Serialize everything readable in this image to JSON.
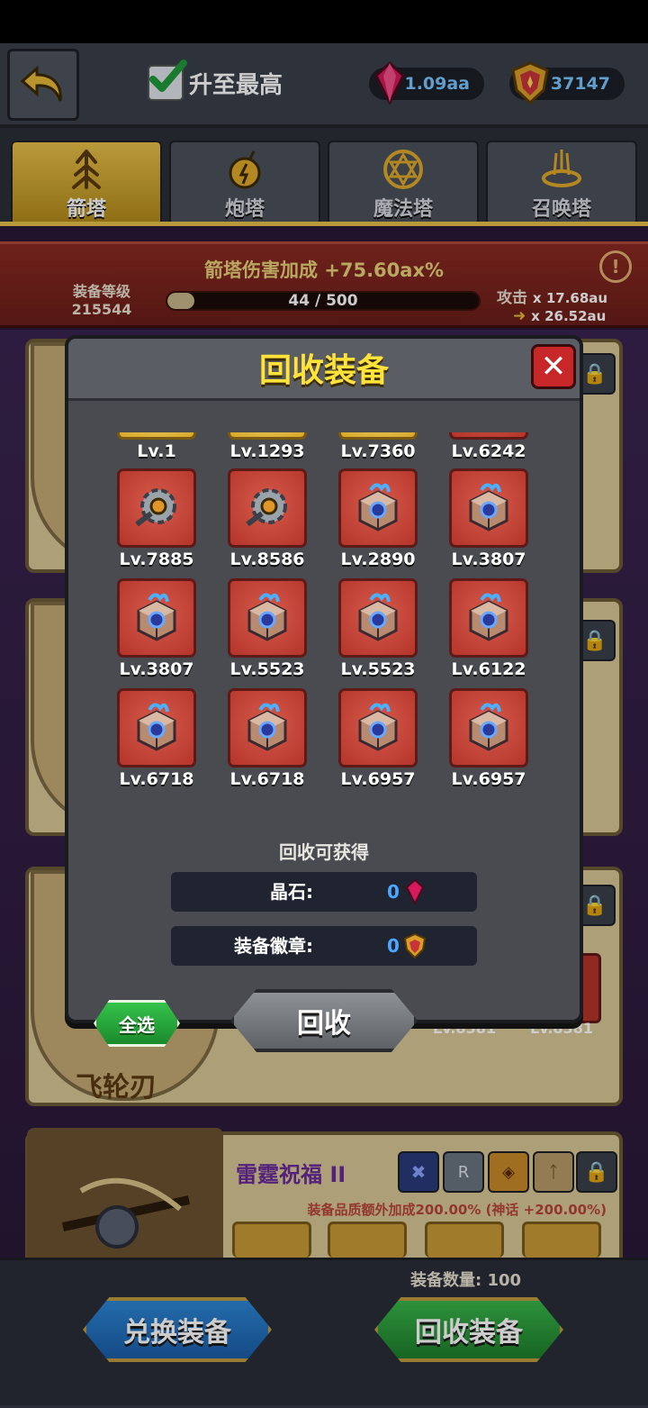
{
  "topbar": {
    "auto_max_label": "升至最高",
    "gems": "1.09aa",
    "badges": "37147"
  },
  "tabs": [
    {
      "label": "箭塔",
      "active": true,
      "icon": "arrow-tower-icon"
    },
    {
      "label": "炮塔",
      "active": false,
      "icon": "cannon-tower-icon"
    },
    {
      "label": "魔法塔",
      "active": false,
      "icon": "magic-tower-icon"
    },
    {
      "label": "召唤塔",
      "active": false,
      "icon": "summon-tower-icon"
    }
  ],
  "bonus": {
    "title": "箭塔伤害加成 +75.60ax%",
    "equip_level_label": "装备等级",
    "equip_level_value": "215544",
    "progress_text": "44 / 500",
    "progress_fraction": 0.088,
    "attack_label": "攻击",
    "attack_current": "x 17.68au",
    "attack_next": "x 26.52au"
  },
  "background_cards": {
    "card3_name": "飞轮刃",
    "card4_name": "雷霆祝福 II",
    "card4_bonus": "装备品质额外加成200.00% (神话 +200.00%)",
    "slot_lv_a": "Lv.8381",
    "slot_lv_b": "Lv.8381"
  },
  "modal": {
    "title": "回收装备",
    "items": [
      {
        "lv": "Lv.1",
        "kind": "gold"
      },
      {
        "lv": "Lv.1293",
        "kind": "gold"
      },
      {
        "lv": "Lv.7360",
        "kind": "gold"
      },
      {
        "lv": "Lv.6242",
        "kind": "red-cube"
      },
      {
        "lv": "Lv.7885",
        "kind": "gear"
      },
      {
        "lv": "Lv.8586",
        "kind": "gear"
      },
      {
        "lv": "Lv.2890",
        "kind": "cube"
      },
      {
        "lv": "Lv.3807",
        "kind": "cube"
      },
      {
        "lv": "Lv.3807",
        "kind": "cube"
      },
      {
        "lv": "Lv.5523",
        "kind": "cube"
      },
      {
        "lv": "Lv.5523",
        "kind": "cube"
      },
      {
        "lv": "Lv.6122",
        "kind": "cube"
      },
      {
        "lv": "Lv.6718",
        "kind": "cube"
      },
      {
        "lv": "Lv.6718",
        "kind": "cube"
      },
      {
        "lv": "Lv.6957",
        "kind": "cube"
      },
      {
        "lv": "Lv.6957",
        "kind": "cube"
      }
    ],
    "reward_title": "回收可获得",
    "crystal_label": "晶石:",
    "crystal_value": "0",
    "badge_label": "装备徽章:",
    "badge_value": "0",
    "select_all": "全选",
    "recycle": "回收"
  },
  "bottom": {
    "equip_count": "装备数量: 100",
    "exchange_button": "兑换装备",
    "recycle_button": "回收装备"
  },
  "colors": {
    "gold": "#e8c14a",
    "gem": "#d8195c",
    "accent_blue": "#4aa8ff",
    "green_button": "#2aa43c",
    "blue_button": "#1f6fb8"
  }
}
